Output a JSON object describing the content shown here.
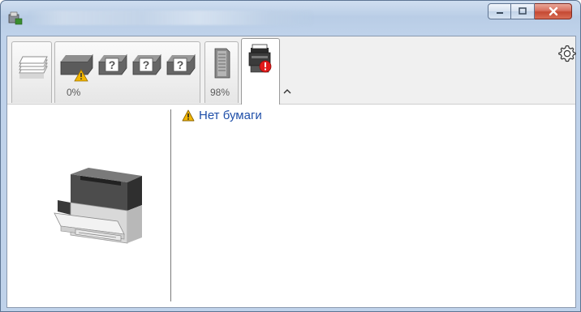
{
  "window": {
    "title": ""
  },
  "tabs": [
    {
      "name": "paper-stack",
      "pct": ""
    },
    {
      "name": "toner",
      "pct": "0%"
    },
    {
      "name": "memory",
      "pct": "98%"
    },
    {
      "name": "printer-status",
      "pct": ""
    }
  ],
  "status": {
    "message": "Нет бумаги"
  },
  "colors": {
    "accent_text": "#1f4fa8",
    "warning": "#f2b600",
    "error": "#e21b1b"
  }
}
